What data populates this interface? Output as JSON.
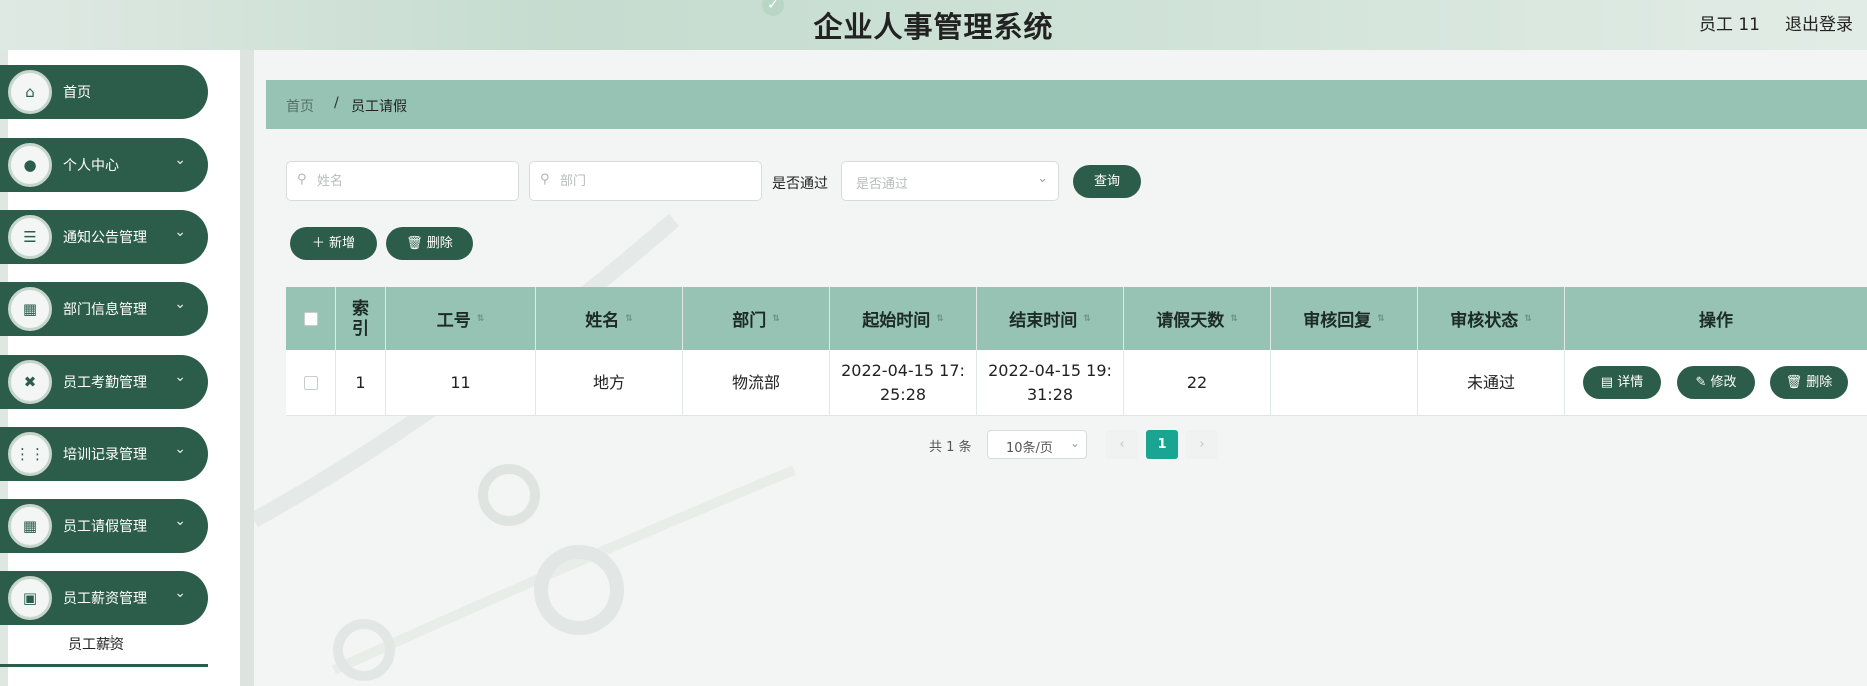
{
  "header": {
    "title": "企业人事管理系统",
    "user": "员工 11",
    "logout": "退出登录"
  },
  "sidebar": {
    "items": [
      {
        "label": "首页",
        "icon": "home-icon",
        "glyph": "⌂",
        "has_chevron": false
      },
      {
        "label": "个人中心",
        "icon": "user-icon",
        "glyph": "●",
        "has_chevron": true
      },
      {
        "label": "通知公告管理",
        "icon": "list-icon",
        "glyph": "☰",
        "has_chevron": true
      },
      {
        "label": "部门信息管理",
        "icon": "grid-icon",
        "glyph": "▦",
        "has_chevron": true
      },
      {
        "label": "员工考勤管理",
        "icon": "video-icon",
        "glyph": "✖",
        "has_chevron": true
      },
      {
        "label": "培训记录管理",
        "icon": "apps-icon",
        "glyph": "⋮⋮",
        "has_chevron": true
      },
      {
        "label": "员工请假管理",
        "icon": "grid-icon",
        "glyph": "▦",
        "has_chevron": true
      },
      {
        "label": "员工薪资管理",
        "icon": "briefcase-icon",
        "glyph": "▣",
        "has_chevron": true
      }
    ],
    "sub_item": "员工薪资"
  },
  "breadcrumb": {
    "home": "首页",
    "separator": "/",
    "current": "员工请假"
  },
  "search": {
    "name_placeholder": "姓名",
    "dept_placeholder": "部门",
    "approved_label": "是否通过",
    "approved_placeholder": "是否通过",
    "query_button": "查询"
  },
  "toolbar": {
    "add_label": "＋ 新增",
    "delete_label": "🗑 删除"
  },
  "table": {
    "headers": [
      "索引",
      "工号",
      "姓名",
      "部门",
      "起始时间",
      "结束时间",
      "请假天数",
      "审核回复",
      "审核状态",
      "操作"
    ],
    "rows": [
      {
        "index": "1",
        "emp_no": "11",
        "name": "地方",
        "dept": "物流部",
        "start": "2022-04-15 17:25:28",
        "start_l1": "2022-04-15 17:",
        "start_l2": "25:28",
        "end_l1": "2022-04-15 19:",
        "end_l2": "31:28",
        "days": "22",
        "reply": "",
        "status": "未通过"
      }
    ],
    "row_actions": [
      "▤ 详情",
      "✎ 修改",
      "🗑 删除"
    ]
  },
  "pagination": {
    "total": "共 1 条",
    "page_size": "10条/页",
    "prev": "‹",
    "current": "1",
    "next": "›"
  },
  "colors": {
    "primary": "#2c5d4b",
    "header_bar": "#96c3b3",
    "page_active": "#1aa592"
  }
}
